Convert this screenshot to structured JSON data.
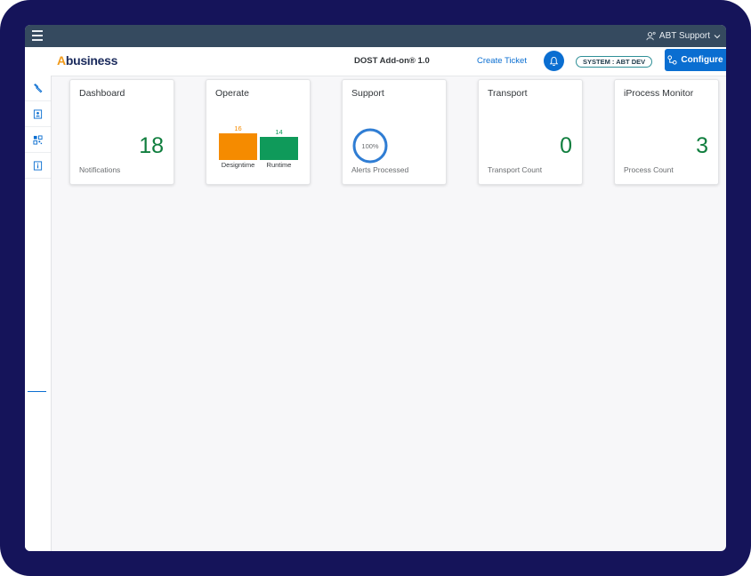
{
  "topbar": {
    "user_label": "ABT Support"
  },
  "header": {
    "logo_accent": "A",
    "logo_text": "business",
    "app_name": "DOST Add-on® 1.0",
    "create_ticket": "Create Ticket",
    "system_badge": "SYSTEM : ABT DEV",
    "configure_label": "Configure"
  },
  "sidebar": {
    "items": [
      "wrench-icon",
      "contact-card-icon",
      "qr-code-icon",
      "info-icon"
    ]
  },
  "tiles": {
    "dashboard": {
      "title": "Dashboard",
      "value": "18",
      "footer": "Notifications"
    },
    "operate": {
      "title": "Operate",
      "chart_data": {
        "type": "bar",
        "categories": [
          "Designtime",
          "Runtime"
        ],
        "values": [
          16,
          14
        ],
        "colors": [
          "#f58b00",
          "#0f9a5a"
        ],
        "ylim": [
          0,
          16
        ]
      }
    },
    "support": {
      "title": "Support",
      "percent_label": "100%",
      "percent": 100,
      "footer": "Alerts Processed"
    },
    "transport": {
      "title": "Transport",
      "value": "0",
      "footer": "Transport Count"
    },
    "iprocess": {
      "title": "iProcess Monitor",
      "value": "3",
      "footer": "Process Count"
    }
  },
  "colors": {
    "accent": "#0a6ed1",
    "shellbar": "#354a5f",
    "positive": "#107e3e",
    "frame": "#15145a"
  }
}
